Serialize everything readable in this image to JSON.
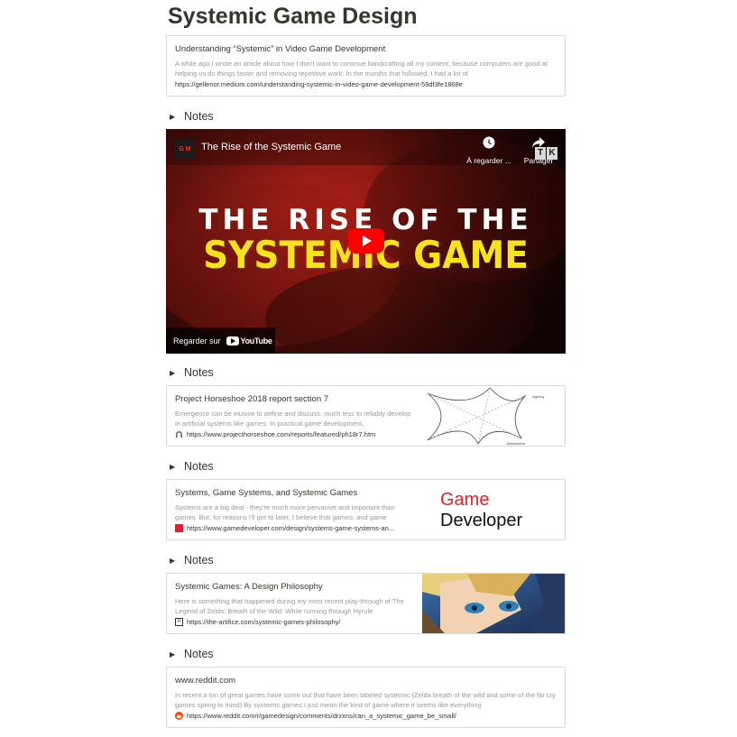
{
  "page": {
    "title": "Systemic Game Design"
  },
  "bookmark1": {
    "title": "Understanding “Systemic” in Video Game Development",
    "description": "A while ago I wrote an article about how I don’t want to continue handcrafting all my content, because computers are good at helping us do things faster and removing repetitive work. In the months that followed, I had a lot of",
    "url": "https://gellenor.medium.com/understanding-systemic-in-video-game-development-59df3fe1868e"
  },
  "toggles": [
    {
      "label": "Notes"
    },
    {
      "label": "Notes"
    },
    {
      "label": "Notes"
    },
    {
      "label": "Notes"
    },
    {
      "label": "Notes"
    }
  ],
  "video": {
    "channel_logo": "G M",
    "title": "The Rise of the Systemic Game",
    "watch_later": "À regarder ...",
    "share": "Partager",
    "headline_line1": "THE RISE OF THE",
    "headline_line2": "SYSTEMIC GAME",
    "watch_on": "Regarder sur",
    "youtube": "YouTube"
  },
  "bookmark2": {
    "title": "Project Horseshoe 2018 report section 7",
    "description": "Emergence can be elusive to define and discuss, much less to reliably develop in artificial systems like games. In practical game development,",
    "url": "https://www.projecthorseshoe.com/reports/featured/ph18r7.htm",
    "diagram_labels": [
      "Agency",
      "Abstraction"
    ]
  },
  "bookmark3": {
    "title": "Systems, Game Systems, and Systemic Games",
    "description": "Systems are a big deal - they're much more pervasive and important than games. But, for reasons I'll get to later, I believe that games, and game",
    "url": "https://www.gamedeveloper.com/design/systems-game-systems-an...",
    "logo_line1": "Game",
    "logo_line2": "Developer"
  },
  "bookmark4": {
    "title": "Systemic Games: A Design Philosophy",
    "description": "Here is something that happened during my most recent play-through of The Legend of Zelda: Breath of the Wild: While running through Hyrule",
    "url": "https://the-artifice.com/systemic-games-philosophy/"
  },
  "bookmark5": {
    "title": "www.reddit.com",
    "description": "In recent a ton of great games have come out that have been labeled systemic (Zelda breath of the wild and some of the far cry games spring to mind).By systemic games I just mean the kind of game where it seems like everything",
    "url": "https://www.reddit.com/r/gamedesign/comments/drzxns/can_a_systemic_game_be_small/"
  },
  "colors": {
    "text": "#37352f",
    "muted": "#9b9a97",
    "border": "#d9d9d7",
    "youtube_red": "#ff0000",
    "headline_yellow": "#f7e31a",
    "game_dev_red": "#e8202a"
  }
}
